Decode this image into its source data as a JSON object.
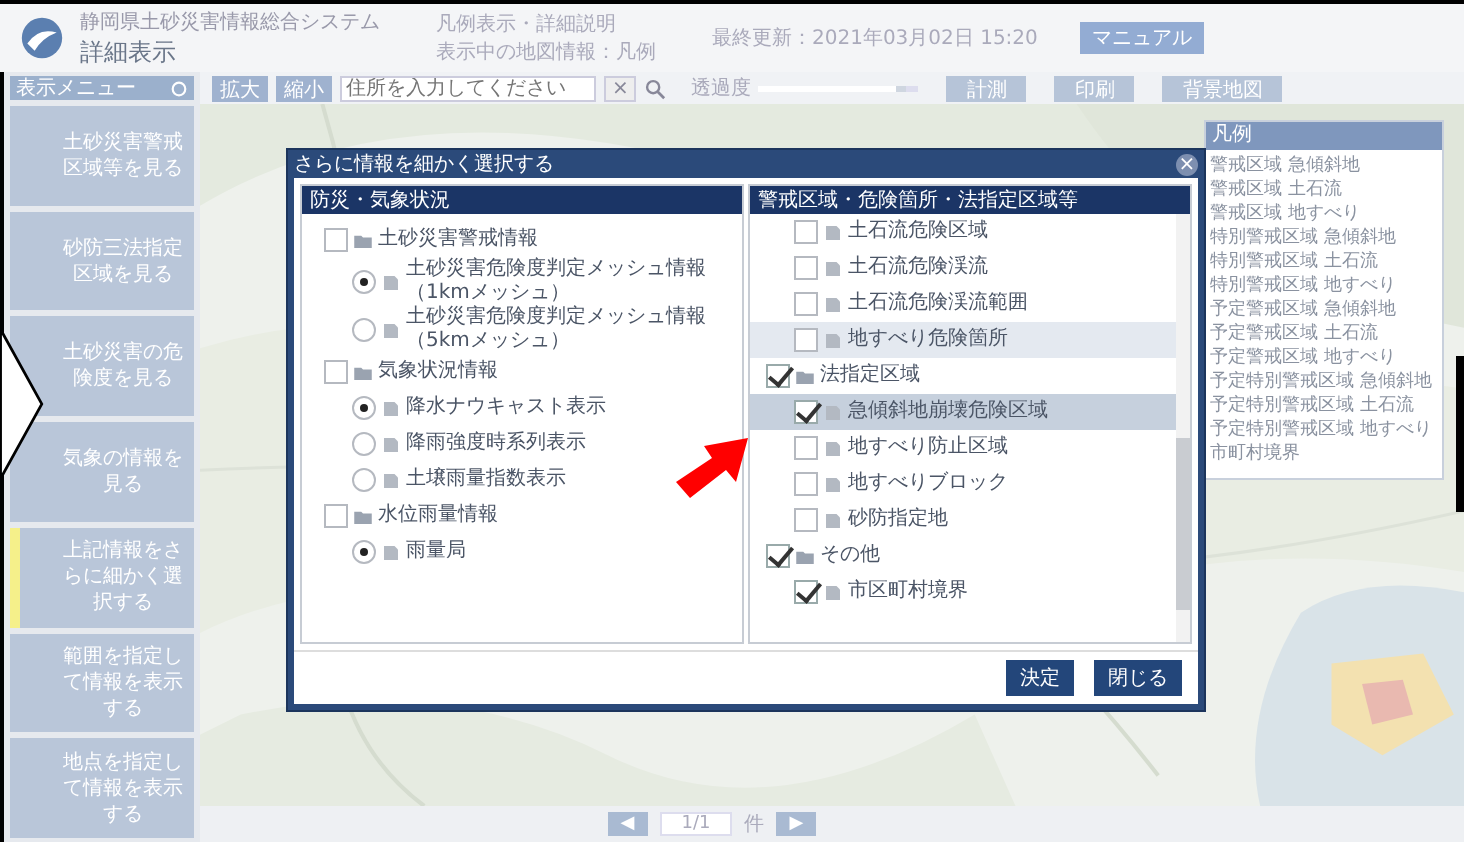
{
  "header": {
    "system_name": "静岡県土砂災害情報総合システム",
    "title": "詳細表示",
    "notes": [
      "凡例表示・詳細説明",
      "表示中の地図情報：凡例"
    ],
    "updated": "最終更新：2021年03月02日 15:20",
    "manual_button": "マニュアル"
  },
  "sidebar": {
    "title": "表示メニュー",
    "items": [
      {
        "label": "土砂災害警戒区域等を見る",
        "selected": false
      },
      {
        "label": "砂防三法指定区域を見る",
        "selected": false
      },
      {
        "label": "土砂災害の危険度を見る",
        "selected": false
      },
      {
        "label": "気象の情報を見る",
        "selected": false
      },
      {
        "label": "上記情報をさらに細かく選択する",
        "selected": true
      },
      {
        "label": "範囲を指定して情報を表示する",
        "selected": false
      },
      {
        "label": "地点を指定して情報を表示する",
        "selected": false
      }
    ]
  },
  "toolbar": {
    "zoom_in": "拡大",
    "zoom_out": "縮小",
    "search": {
      "placeholder": "住所を入力してください"
    },
    "clear": "×",
    "opacity_label": "透過度",
    "opacity": {
      "level": 0.92
    },
    "buttons": [
      "計測",
      "印刷",
      "背景地図"
    ]
  },
  "dialog": {
    "title": "さらに情報を細かく選択する",
    "close": "×",
    "left": {
      "header": "防災・気象状況",
      "tree": [
        {
          "label": "土砂災害警戒情報",
          "checked": false,
          "children": [
            {
              "label": "土砂災害危険度判定メッシュ情報（1kmメッシュ）",
              "selected": true
            },
            {
              "label": "土砂災害危険度判定メッシュ情報（5kmメッシュ）",
              "selected": false
            }
          ]
        },
        {
          "label": "気象状況情報",
          "checked": false,
          "children": [
            {
              "label": "降水ナウキャスト表示",
              "selected": true
            },
            {
              "label": "降雨強度時系列表示",
              "selected": false
            },
            {
              "label": "土壌雨量指数表示",
              "selected": false
            }
          ]
        },
        {
          "label": "水位雨量情報",
          "checked": false,
          "children": [
            {
              "label": "雨量局",
              "selected": true
            }
          ]
        }
      ]
    },
    "right": {
      "header": "警戒区域・危険箇所・法指定区域等",
      "tree": [
        {
          "children": [
            {
              "label": "土石流危険区域",
              "checked": false,
              "selected": false,
              "hovered": false
            },
            {
              "label": "土石流危険渓流",
              "checked": false,
              "selected": false,
              "hovered": false
            },
            {
              "label": "土石流危険渓流範囲",
              "checked": false,
              "selected": false,
              "hovered": false
            },
            {
              "label": "地すべり危険箇所",
              "checked": false,
              "selected": false,
              "hovered": true
            }
          ]
        },
        {
          "label": "法指定区域",
          "checked": true,
          "children": [
            {
              "label": "急傾斜地崩壊危険区域",
              "checked": true,
              "selected": true,
              "hovered": false
            },
            {
              "label": "地すべり防止区域",
              "checked": false,
              "selected": false,
              "hovered": false
            },
            {
              "label": "地すべりブロック",
              "checked": false,
              "selected": false,
              "hovered": false
            },
            {
              "label": "砂防指定地",
              "checked": false,
              "selected": false,
              "hovered": false
            }
          ]
        },
        {
          "label": "その他",
          "checked": true,
          "children": [
            {
              "label": "市区町村境界",
              "checked": true,
              "selected": false,
              "hovered": false
            }
          ]
        }
      ]
    },
    "buttons": [
      "決定",
      "閉じる"
    ]
  },
  "legend": {
    "title": "凡例",
    "items": [
      "警戒区域 急傾斜地",
      "警戒区域 土石流",
      "警戒区域 地すべり",
      "特別警戒区域 急傾斜地",
      "特別警戒区域 土石流",
      "特別警戒区域 地すべり",
      "予定警戒区域 急傾斜地",
      "予定警戒区域 土石流",
      "予定警戒区域 地すべり",
      "予定特別警戒区域 急傾斜地",
      "予定特別警戒区域 土石流",
      "予定特別警戒区域 地すべり",
      "市町村境界"
    ]
  },
  "pager": {
    "prev": "◀",
    "page": "1/1",
    "unit": "件",
    "next": "▶"
  }
}
